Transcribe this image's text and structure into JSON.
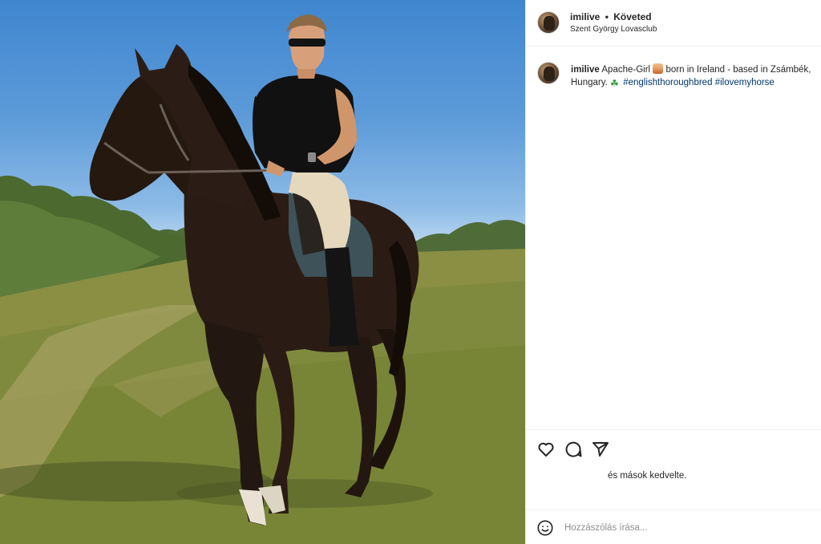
{
  "post": {
    "username": "imilive",
    "separator": "•",
    "follow_status": "Követed",
    "location": "Szent György Lovasclub"
  },
  "caption": {
    "username": "imilive",
    "text_before_emoji": "Apache-Girl",
    "emoji_1": "person-emoji",
    "text_middle": "born in Ireland - based in Zsámbék, Hungary.",
    "emoji_2": "shamrock-emoji",
    "hashtags": [
      "#englishthoroughbred",
      "#ilovemyhorse"
    ]
  },
  "actions": {
    "icons": [
      "heart-icon",
      "comment-icon",
      "share-icon"
    ],
    "likes_text": "és mások kedvelte."
  },
  "comment": {
    "placeholder": "Hozzászólás írása...",
    "emoji_icon": "smiley-icon"
  },
  "colors": {
    "link": "#00376b",
    "text": "#262626",
    "muted": "#8e8e8e",
    "border": "#efefef"
  }
}
